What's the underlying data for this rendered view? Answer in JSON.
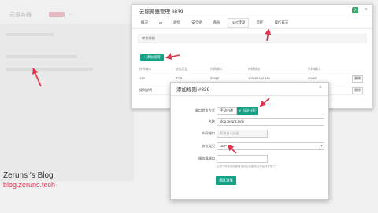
{
  "background": {
    "title": "云服务器",
    "subtitle": "—",
    "footer_line1": "Zeruns 's Blog",
    "footer_line2": "blog.zeruns.tech"
  },
  "dialog1": {
    "title": "云服务器管理 #839",
    "tabs": [
      "概况",
      "IP",
      "硬盘",
      "安全组",
      "备份",
      "NAT转发",
      "监控",
      "操作日志"
    ],
    "active_tab": "NAT转发",
    "segment_label": "转发规则",
    "add_button": "+ 添加规则",
    "table": {
      "headers": [
        "外网端口",
        "协议类型",
        "内网端口",
        "外网地址",
        "外网端口",
        ""
      ],
      "rows": [
        {
          "c0": "123",
          "c1": "TCP",
          "c2": "25310",
          "c3": "103.45.162.186",
          "c4": "30a67",
          "action": "删除"
        },
        {
          "c0": "规则说明",
          "c1": "UDP",
          "c2": "…",
          "c3": "103.45.162.186",
          "c4": "…",
          "action": "删除"
        }
      ]
    }
  },
  "dialog2": {
    "title": "添加规则 #839",
    "mode_label": "端口转发方式",
    "mode_options": [
      "手动分配",
      "自动分配"
    ],
    "mode_selected": "自动分配",
    "name_label": "名称",
    "name_value": "blog.zeruns.tech",
    "ext_port_label": "外网端口",
    "ext_port_placeholder": "系统自动分配",
    "protocol_label": "协议类型",
    "protocol_value": "UDP",
    "internal_port_label": "服务器端口",
    "internal_port_value": "",
    "hint": "云端口转发规则配置将在启动服务后开始转发端口",
    "confirm_button": "确认添加"
  },
  "colors": {
    "accent": "#16a085",
    "arrow": "#e0334d",
    "footer_red": "#e0334d"
  }
}
